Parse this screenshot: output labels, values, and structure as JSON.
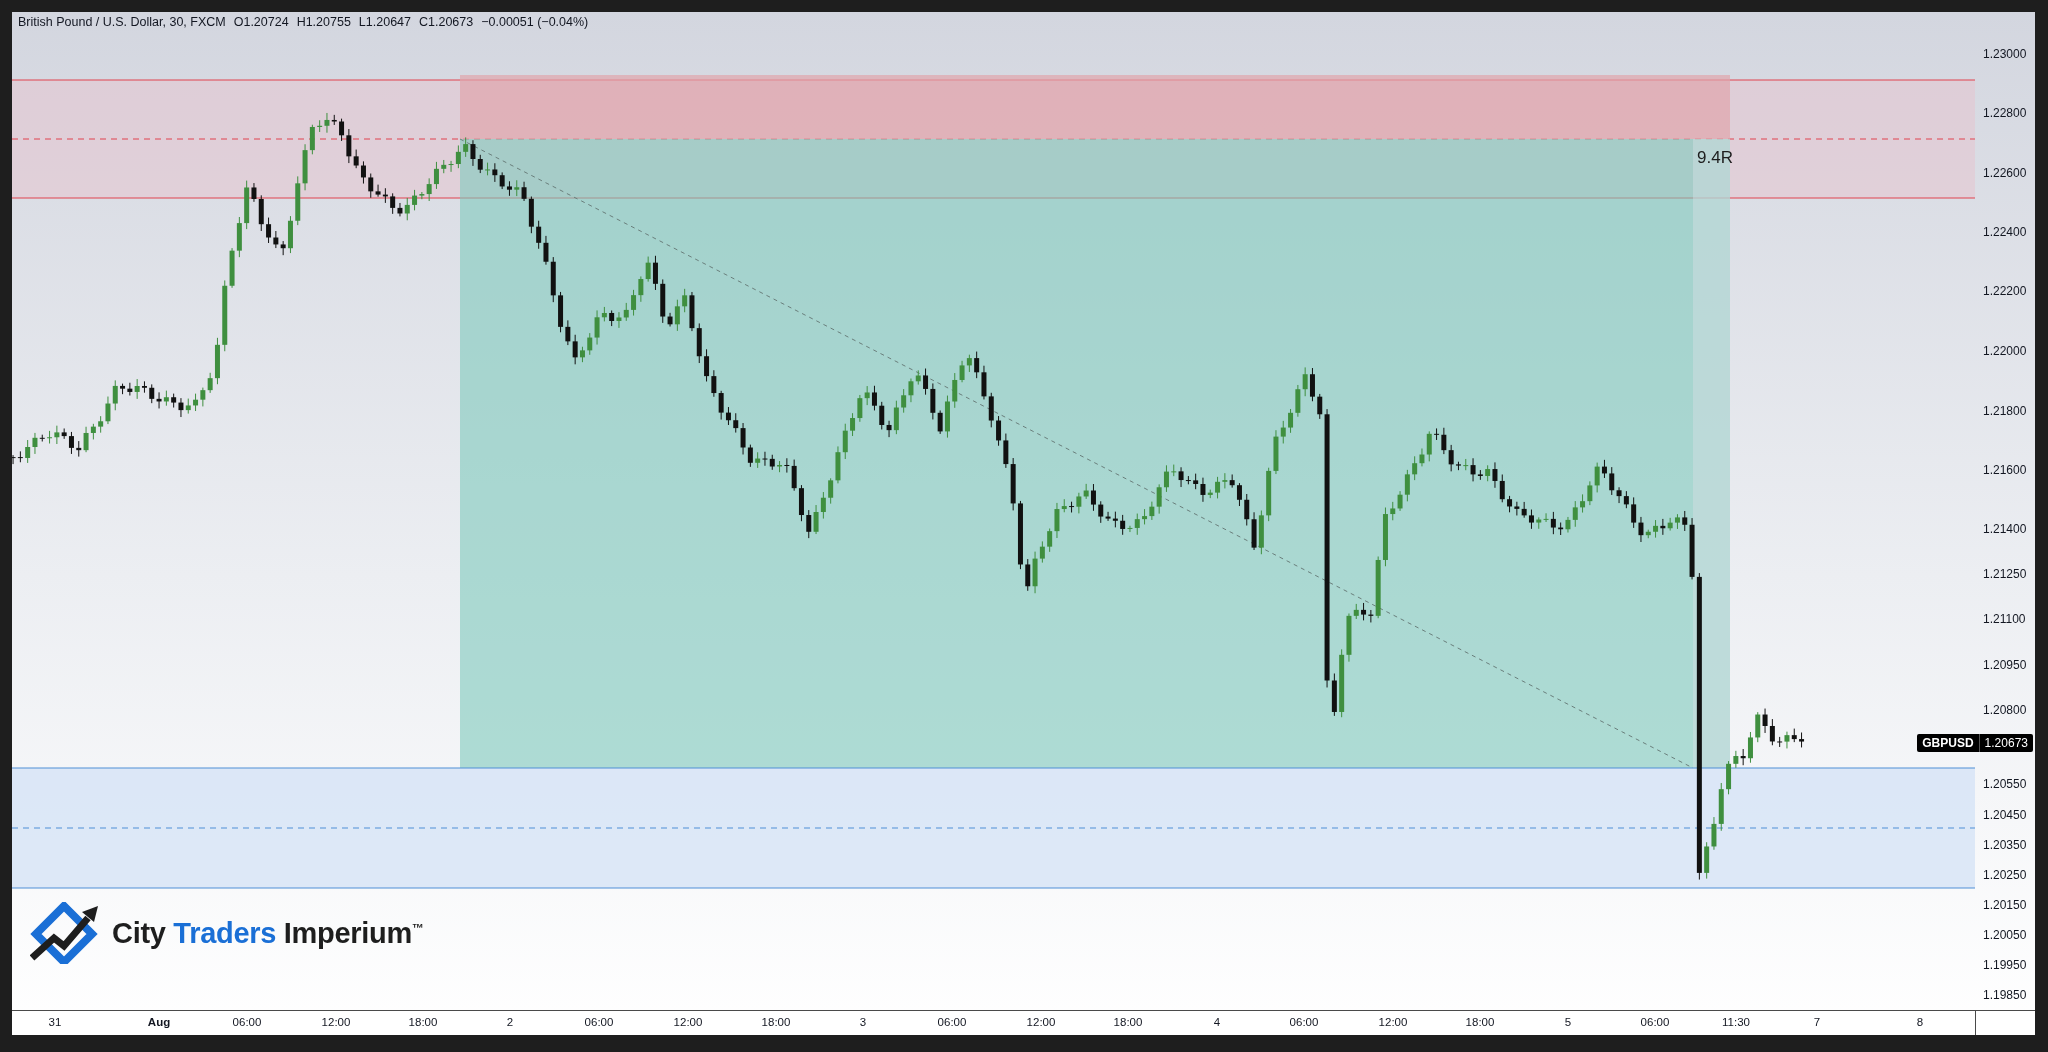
{
  "legend": {
    "instrument": "British Pound / U.S. Dollar, 30, FXCM",
    "open": "O1.20724",
    "high": "H1.20755",
    "low": "L1.20647",
    "close": "C1.20673",
    "change": "−0.00051 (−0.04%)"
  },
  "position": {
    "label": "9.4R"
  },
  "price_axis": {
    "ticks": [
      "1.23000",
      "1.22800",
      "1.22600",
      "1.22400",
      "1.22200",
      "1.22000",
      "1.21800",
      "1.21600",
      "1.21400",
      "1.21250",
      "1.21100",
      "1.20950",
      "1.20800",
      "1.20550",
      "1.20450",
      "1.20350",
      "1.20250",
      "1.20150",
      "1.20050",
      "1.19950",
      "1.19850"
    ]
  },
  "price_badge": {
    "symbol": "GBPUSD",
    "price": "1.20673"
  },
  "time_axis": {
    "ticks": [
      {
        "label": "31",
        "bold": false
      },
      {
        "label": "Aug",
        "bold": true
      },
      {
        "label": "06:00",
        "bold": false
      },
      {
        "label": "12:00",
        "bold": false
      },
      {
        "label": "18:00",
        "bold": false
      },
      {
        "label": "2",
        "bold": false
      },
      {
        "label": "06:00",
        "bold": false
      },
      {
        "label": "12:00",
        "bold": false
      },
      {
        "label": "18:00",
        "bold": false
      },
      {
        "label": "3",
        "bold": false
      },
      {
        "label": "06:00",
        "bold": false
      },
      {
        "label": "12:00",
        "bold": false
      },
      {
        "label": "18:00",
        "bold": false
      },
      {
        "label": "4",
        "bold": false
      },
      {
        "label": "06:00",
        "bold": false
      },
      {
        "label": "12:00",
        "bold": false
      },
      {
        "label": "18:00",
        "bold": false
      },
      {
        "label": "5",
        "bold": false
      },
      {
        "label": "06:00",
        "bold": false
      },
      {
        "label": "11:30",
        "bold": false
      },
      {
        "label": "7",
        "bold": false
      },
      {
        "label": "8",
        "bold": false
      }
    ]
  },
  "logo": {
    "before": "City ",
    "highlight": "Traders",
    "after": " Imperium",
    "trademark": "™"
  }
}
